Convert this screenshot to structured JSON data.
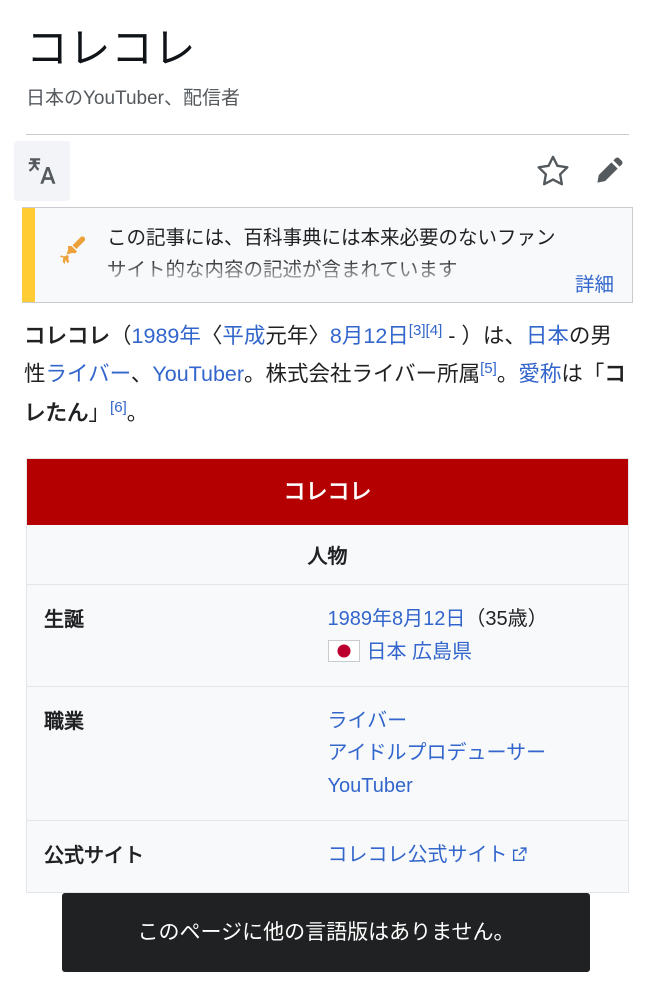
{
  "page": {
    "title": "コレコレ",
    "subtitle": "日本のYouTuber、配信者"
  },
  "toolbar": {
    "language_label": "文A",
    "language_icon": "translate-icon",
    "watch_icon": "star-outline-icon",
    "edit_icon": "pencil-icon"
  },
  "notice": {
    "icon": "broom-icon",
    "text": "この記事には、百科事典には本来必要のないファンサイト的な内容の記述が含まれています",
    "more_label": "詳細",
    "bar_color": "#ffcc33"
  },
  "lead": {
    "name": "コレコレ",
    "open_paren": "（",
    "year": "1989年",
    "era_open": "〈",
    "era": "平成",
    "era_tail": "元年〉",
    "date": "8月12日",
    "ref_3": "[3]",
    "ref_4": "[4]",
    "dash_close": " - ）",
    "t1": "は、",
    "country": "日本",
    "t2": "の男性",
    "occupation": "ライバー",
    "t3": "、",
    "youtuber": "YouTuber",
    "t4": "。株式会社ライバー所属",
    "ref_5": "[5]",
    "t5": "。",
    "nickname_label": "愛称",
    "t6": "は「",
    "nickname": "コレたん",
    "t7": "」",
    "ref_6": "[6]",
    "t8": "。"
  },
  "infobox": {
    "title": "コレコレ",
    "section": "人物",
    "title_bg": "#b40000",
    "rows": [
      {
        "label": "生誕",
        "value_date": "1989年8月12日",
        "value_age": "（35歳）",
        "flag_icon": "japan-flag-icon",
        "value_place": "日本 広島県"
      },
      {
        "label": "職業",
        "occupations": [
          "ライバー",
          "アイドルプロデューサー",
          "YouTuber"
        ]
      },
      {
        "label": "公式サイト",
        "site_label": "コレコレ公式サイト",
        "ext_icon": "external-link-icon"
      }
    ]
  },
  "toast": {
    "message": "このページに他の言語版はありません。"
  }
}
